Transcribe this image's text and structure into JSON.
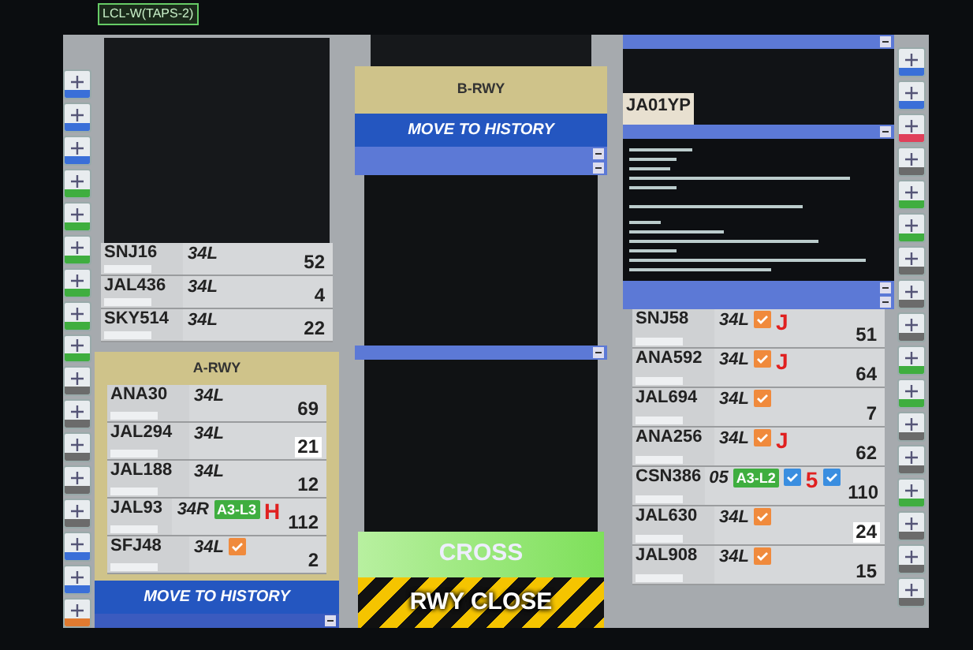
{
  "screen_tag": "LCL-W(TAPS-2)",
  "left_toolbar": [
    {
      "color": "#3a6fd8"
    },
    {
      "color": "#3a6fd8"
    },
    {
      "color": "#3a6fd8"
    },
    {
      "color": "#3fae3f"
    },
    {
      "color": "#3fae3f"
    },
    {
      "color": "#3fae3f"
    },
    {
      "color": "#3fae3f"
    },
    {
      "color": "#3fae3f"
    },
    {
      "color": "#3fae3f"
    },
    {
      "color": "#6b6b6b"
    },
    {
      "color": "#6b6b6b"
    },
    {
      "color": "#6b6b6b"
    },
    {
      "color": "#6b6b6b"
    },
    {
      "color": "#6b6b6b"
    },
    {
      "color": "#3a6fd8"
    },
    {
      "color": "#3a6fd8"
    },
    {
      "color": "#e07a30"
    }
  ],
  "left_strips": [
    {
      "callsign": "SNJ16",
      "runway": "34L",
      "number": "52",
      "number_highlighted": false
    },
    {
      "callsign": "JAL436",
      "runway": "34L",
      "number": "4",
      "number_highlighted": false
    },
    {
      "callsign": "SKY514",
      "runway": "34L",
      "number": "22",
      "number_highlighted": false
    }
  ],
  "a_rwy": {
    "title": "A-RWY",
    "strips": [
      {
        "callsign": "ANA30",
        "runway": "34L",
        "number": "69",
        "number_highlighted": false
      },
      {
        "callsign": "JAL294",
        "runway": "34L",
        "number": "21",
        "number_highlighted": true
      },
      {
        "callsign": "JAL188",
        "runway": "34L",
        "number": "12",
        "number_highlighted": false
      },
      {
        "callsign": "JAL93",
        "runway": "34R",
        "number": "112",
        "number_highlighted": false,
        "marks": [
          {
            "kind": "tag",
            "text": "A3-L3",
            "color": "#3fae3f"
          },
          {
            "kind": "letter",
            "text": "H",
            "color": "#e02020"
          }
        ]
      },
      {
        "callsign": "SFJ48",
        "runway": "34L",
        "number": "2",
        "number_highlighted": false,
        "marks": [
          {
            "kind": "check",
            "color": "#f08a3c"
          }
        ]
      }
    ],
    "button": "MOVE TO HISTORY"
  },
  "b_rwy": {
    "title": "B-RWY",
    "button": "MOVE TO HISTORY",
    "cross": "CROSS",
    "close": "RWY CLOSE"
  },
  "right": {
    "aircraft_tag": "JA01YP",
    "strips": [
      {
        "callsign": "SNJ58",
        "runway": "34L",
        "number": "51",
        "number_highlighted": false,
        "marks": [
          {
            "kind": "check",
            "color": "#f08a3c"
          },
          {
            "kind": "letter",
            "text": "J",
            "color": "#e02020"
          }
        ]
      },
      {
        "callsign": "ANA592",
        "runway": "34L",
        "number": "64",
        "number_highlighted": false,
        "marks": [
          {
            "kind": "check",
            "color": "#f08a3c"
          },
          {
            "kind": "letter",
            "text": "J",
            "color": "#e02020"
          }
        ]
      },
      {
        "callsign": "JAL694",
        "runway": "34L",
        "number": "7",
        "number_highlighted": false,
        "marks": [
          {
            "kind": "check",
            "color": "#f08a3c"
          }
        ]
      },
      {
        "callsign": "ANA256",
        "runway": "34L",
        "number": "62",
        "number_highlighted": false,
        "marks": [
          {
            "kind": "check",
            "color": "#f08a3c"
          },
          {
            "kind": "letter",
            "text": "J",
            "color": "#e02020"
          }
        ]
      },
      {
        "callsign": "CSN386",
        "runway": "05",
        "number": "110",
        "number_highlighted": false,
        "marks": [
          {
            "kind": "tag",
            "text": "A3-L2",
            "color": "#3fae3f"
          },
          {
            "kind": "check",
            "color": "#3a8ee0"
          },
          {
            "kind": "letter",
            "text": "5",
            "color": "#e02020"
          },
          {
            "kind": "check",
            "color": "#3a8ee0"
          }
        ]
      },
      {
        "callsign": "JAL630",
        "runway": "34L",
        "number": "24",
        "number_highlighted": true,
        "marks": [
          {
            "kind": "check",
            "color": "#f08a3c"
          }
        ]
      },
      {
        "callsign": "JAL908",
        "runway": "34L",
        "number": "15",
        "number_highlighted": false,
        "marks": [
          {
            "kind": "check",
            "color": "#f08a3c"
          }
        ]
      }
    ]
  },
  "right_toolbar": [
    {
      "color": "#3a6fd8"
    },
    {
      "color": "#3a6fd8"
    },
    {
      "color": "#e0405a"
    },
    {
      "color": "#6b6b6b"
    },
    {
      "color": "#3fae3f"
    },
    {
      "color": "#3fae3f"
    },
    {
      "color": "#6b6b6b"
    },
    {
      "color": "#6b6b6b"
    },
    {
      "color": "#6b6b6b"
    },
    {
      "color": "#3fae3f"
    },
    {
      "color": "#3fae3f"
    },
    {
      "color": "#6b6b6b"
    },
    {
      "color": "#6b6b6b"
    },
    {
      "color": "#3fae3f"
    },
    {
      "color": "#6b6b6b"
    },
    {
      "color": "#6b6b6b"
    },
    {
      "color": "#6b6b6b"
    }
  ]
}
